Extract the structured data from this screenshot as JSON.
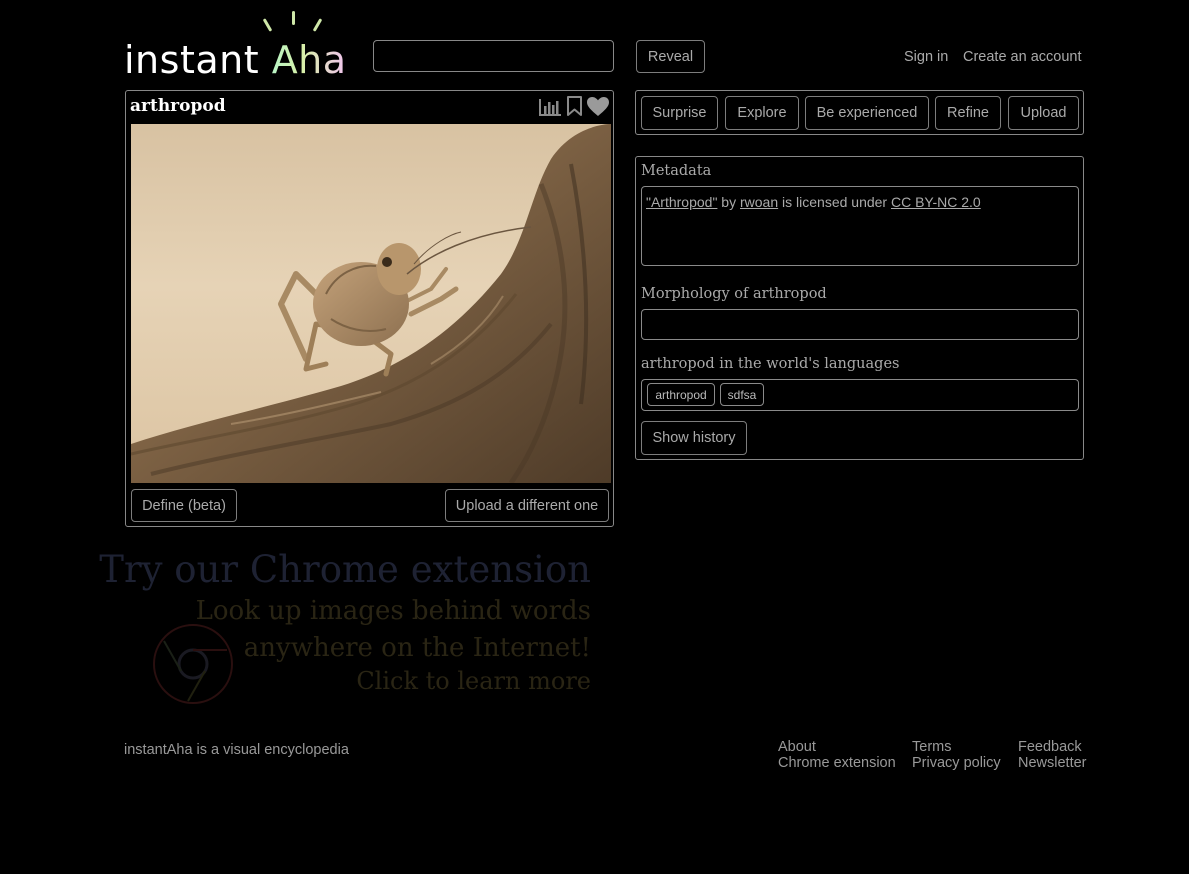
{
  "header": {
    "logo_text_a": "instant ",
    "logo_text_b": "Aha",
    "search": {
      "value": "",
      "placeholder": ""
    },
    "reveal_label": "Reveal",
    "sign_in_label": "Sign in",
    "create_account_label": "Create an account"
  },
  "word_card": {
    "title": "arthropod",
    "image_alt": "arthropod",
    "define_label": "Define (beta)",
    "upload_different_label": "Upload a different one"
  },
  "actions": [
    "Surprise",
    "Explore",
    "Be experienced",
    "Refine",
    "Upload"
  ],
  "metadata": {
    "heading": "Metadata",
    "title_link": "\"Arthropod\"",
    "by_text": " by ",
    "author_link": "rwoan",
    "licensed_text": " is licensed under ",
    "license_link": "CC BY-NC 2.0"
  },
  "morphology": {
    "heading": "Morphology of arthropod",
    "value": ""
  },
  "languages": {
    "heading": "arthropod in the world's languages",
    "tags": [
      "arthropod",
      "sdfsa"
    ]
  },
  "show_history_label": "Show history",
  "promo": {
    "line1": "Try our Chrome extension",
    "line2": "Look up images behind words",
    "line3": "anywhere on the Internet!",
    "line4": "Click to learn more"
  },
  "footer": {
    "tagline": "instantAha is a visual encyclopedia",
    "about": "About",
    "chrome_extension": "Chrome extension",
    "terms": "Terms",
    "privacy": "Privacy policy",
    "feedback": "Feedback",
    "newsletter": "Newsletter"
  },
  "colors": {
    "background": "#000000",
    "border": "#888888",
    "text": "#aaaaaa",
    "logo_gradient_start": "#b9f5c6",
    "logo_gradient_end": "#f2c4f0",
    "promo_title": "#1e2233",
    "promo_text": "#2a2514"
  }
}
